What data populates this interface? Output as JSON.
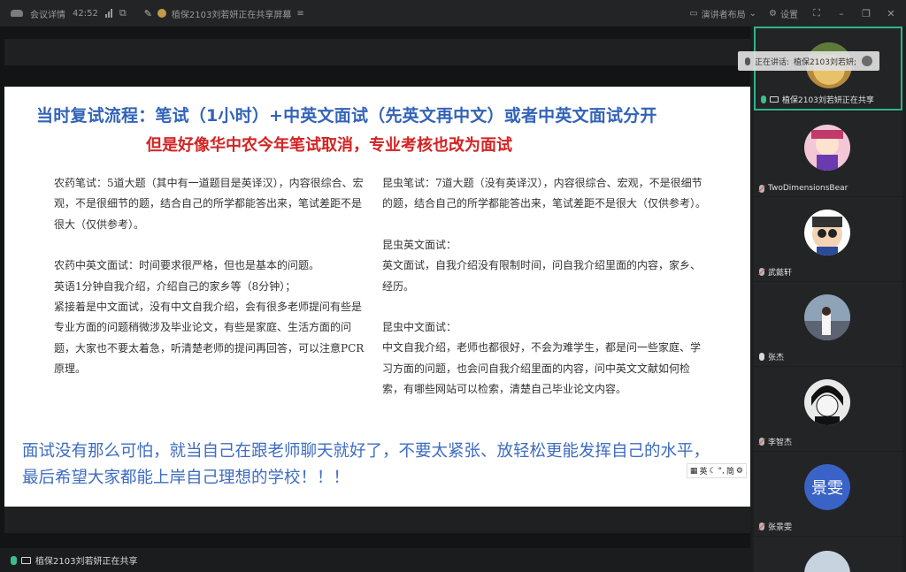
{
  "topbar": {
    "app_name": "会议详情",
    "duration": "42:52",
    "share_notice": "植保2103刘若妍正在共享屏幕",
    "view_mode": "演讲者布局",
    "settings": "设置"
  },
  "slide": {
    "title_line1": "当时复试流程：笔试（1小时）+中英文面试（先英文再中文）或者中英文面试分开",
    "title_line2": "但是好像华中农今年笔试取消，专业考核也改为面试",
    "left_col": [
      "农药笔试：5道大题（其中有一道题目是英译汉），内容很综合、宏观，不是很细节的题，结合自己的所学都能答出来，笔试差距不是很大（仅供参考）。",
      "",
      "农药中英文面试：时间要求很严格，但也是基本的问题。",
      "英语1分钟自我介绍，介绍自己的家乡等（8分钟）；",
      "紧接着是中文面试，没有中文自我介绍，会有很多老师提问有些是专业方面的问题稍微涉及毕业论文，有些是家庭、生活方面的问题，大家也不要太着急，听清楚老师的提问再回答，可以注意PCR原理。"
    ],
    "right_col": [
      "昆虫笔试：7道大题（没有英译汉），内容很综合、宏观，不是很细节的题，结合自己的所学都能答出来，笔试差距不是很大（仅供参考）。",
      "",
      "昆虫英文面试：",
      "英文面试，自我介绍没有限制时间，问自我介绍里面的内容，家乡、经历。",
      "",
      "昆虫中文面试：",
      "中文自我介绍，老师也都很好，不会为难学生，都是问一些家庭、学习方面的问题，也会问自我介绍里面的内容，问中英文文献如何检索，有哪些网站可以检索，清楚自己毕业论文内容。"
    ],
    "bottom_text": "面试没有那么可怕，就当自己在跟老师聊天就好了，不要太紧张、放轻松更能发挥自己的水平，最后希望大家都能上岸自己理想的学校！！！",
    "ime_label": "英",
    "ime_mode": "简"
  },
  "status": {
    "sharing_text": "植保2103刘若妍正在共享"
  },
  "sidebar": {
    "speaking_label": "正在讲话:",
    "speaking_name": "植保2103刘若妍;",
    "participants": [
      {
        "name": "植保2103刘若妍正在共享"
      },
      {
        "name": "TwoDimensionsBear"
      },
      {
        "name": "武懿轩"
      },
      {
        "name": "张杰"
      },
      {
        "name": "李智杰"
      },
      {
        "name": "张景雯",
        "avatar_text": "景雯"
      }
    ]
  },
  "colors": {
    "accent_green": "#2fb38a",
    "title_blue": "#3263b8",
    "title_red": "#d42222",
    "bottom_blue": "#3e6cc0"
  }
}
